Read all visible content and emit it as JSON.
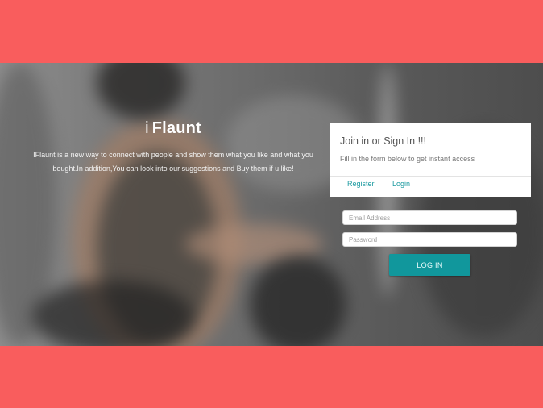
{
  "brand": {
    "prefix": "i",
    "name": "Flaunt"
  },
  "tagline": "IFlaunt is a new way to connect with people and show them what you like and what you bought.In addition,You can look into our suggestions and Buy them if u like!",
  "panel": {
    "title": "Join in or Sign In !!!",
    "subtitle": "Fill in the form below to get instant access",
    "tabs": {
      "register": "Register",
      "login": "Login"
    }
  },
  "form": {
    "email_placeholder": "Email Address",
    "password_placeholder": "Password",
    "login_button": "LOG IN"
  },
  "colors": {
    "band": "#f95d5d",
    "accent": "#11979c",
    "link": "#1c9aa0"
  }
}
